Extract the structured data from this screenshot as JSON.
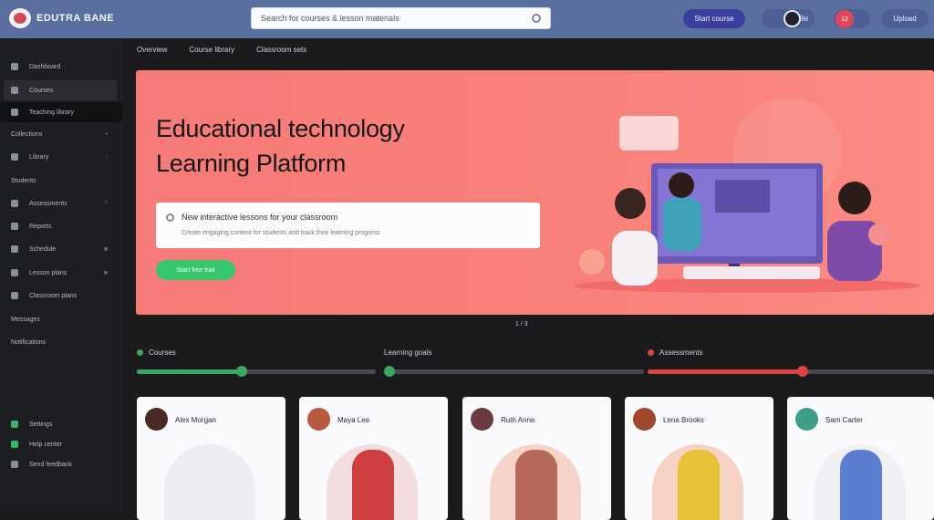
{
  "app": {
    "logo_text": "EDUTRA BANE"
  },
  "search": {
    "value": "Search for courses & lesson materials"
  },
  "header": {
    "primary_button": "Start course",
    "user_label": "Profile",
    "notif_count": "12",
    "right_button": "Upload"
  },
  "sidebar": {
    "items": [
      {
        "label": "Dashboard",
        "icon": "grid-icon"
      },
      {
        "label": "Courses",
        "icon": "book-icon"
      },
      {
        "label": "Teaching library",
        "icon": "library-icon"
      },
      {
        "label": "Collections",
        "icon": "folder-icon"
      },
      {
        "label": "Library",
        "icon": "stack-icon"
      },
      {
        "label": "Students",
        "icon": "users-icon"
      },
      {
        "label": "Assessments",
        "icon": "clipboard-icon"
      },
      {
        "label": "Reports",
        "icon": "chart-icon"
      },
      {
        "label": "Schedule",
        "icon": "calendar-icon"
      },
      {
        "label": "Lesson plans",
        "icon": "document-icon"
      },
      {
        "label": "Classroom plans",
        "icon": "classroom-icon"
      },
      {
        "label": "Messages",
        "icon": "message-icon"
      },
      {
        "label": "Notifications",
        "icon": "bell-icon"
      }
    ],
    "bottom": [
      {
        "label": "Settings",
        "icon": "gear-icon"
      },
      {
        "label": "Help center",
        "icon": "help-icon"
      },
      {
        "label": "Send feedback",
        "icon": "feedback-icon"
      }
    ]
  },
  "tabs": [
    "Overview",
    "Course library",
    "Classroom sets"
  ],
  "hero": {
    "title_line1": "Educational technology",
    "title_line2": "Learning Platform",
    "question": "New interactive lessons for your classroom",
    "subtext": "Create engaging content for students and track their learning progress",
    "cta": "Start free trial"
  },
  "pager": "1 / 3",
  "progress": [
    {
      "label": "Courses",
      "percent": 44,
      "color": "#3aa85e"
    },
    {
      "label": "Learning goals",
      "percent": 2,
      "color": "#3aa85e"
    },
    {
      "label": "Assessments",
      "percent": 54,
      "color": "#d9453f"
    }
  ],
  "cards": [
    {
      "name": "Alex Morgan",
      "avatar_color": "#4a2a24",
      "blob": "#ececf1",
      "person": "#ececf1"
    },
    {
      "name": "Maya Lee",
      "avatar_color": "#b8583e",
      "blob": "#f2dede",
      "person": "#cf3f3f"
    },
    {
      "name": "Ruth Anne",
      "avatar_color": "#6b3a40",
      "blob": "#f6d3c8",
      "person": "#b86a5a"
    },
    {
      "name": "Lena Brooks",
      "avatar_color": "#a0462d",
      "blob": "#f6d2c5",
      "person": "#e6c235"
    },
    {
      "name": "Sam Carter",
      "avatar_color": "#3f9e8a",
      "blob": "#f0f0f4",
      "person": "#5a7fd0"
    }
  ]
}
